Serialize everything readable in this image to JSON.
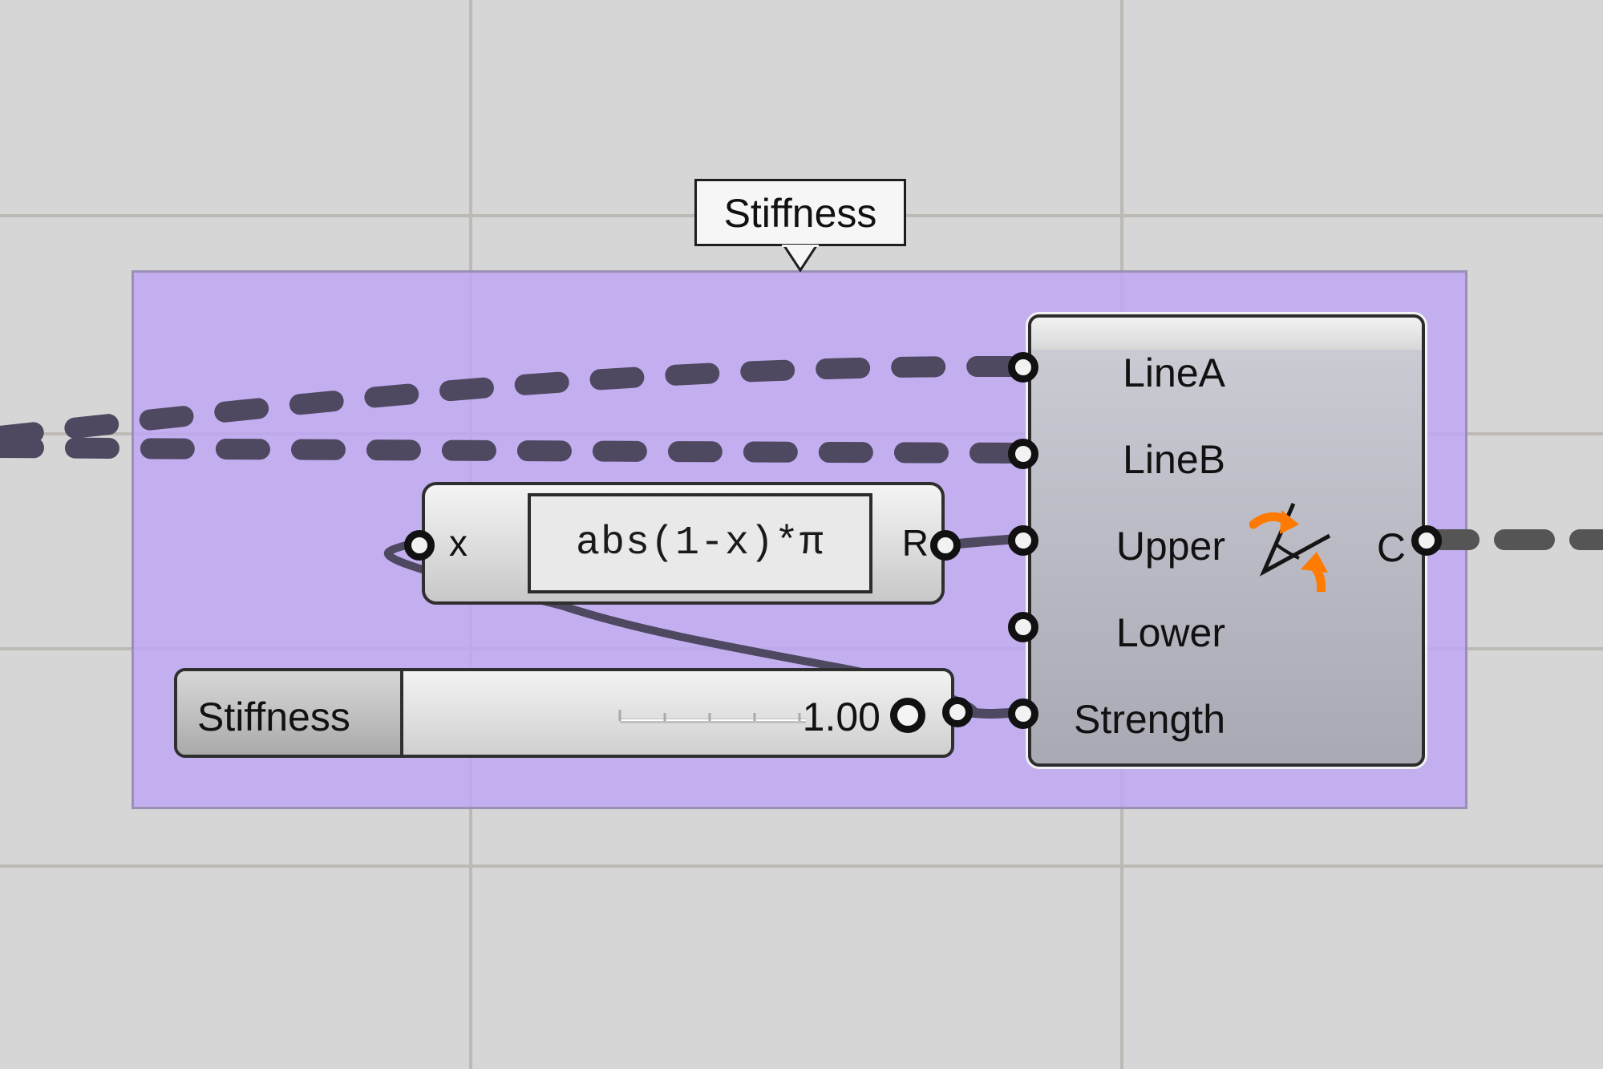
{
  "group": {
    "label": "Stiffness",
    "color": "#c4aef0"
  },
  "expression": {
    "input_label": "x",
    "formula": "abs(1-x)*π",
    "output_label": "R"
  },
  "slider": {
    "name": "Stiffness",
    "value": "1.00"
  },
  "component": {
    "inputs": [
      "LineA",
      "LineB",
      "Upper",
      "Lower",
      "Strength"
    ],
    "output": "C",
    "icon": "angle-goal-icon",
    "icon_accent_color": "#ff7a00"
  },
  "colors": {
    "canvas": "#d6d6d6",
    "wire": "#4e4860"
  }
}
